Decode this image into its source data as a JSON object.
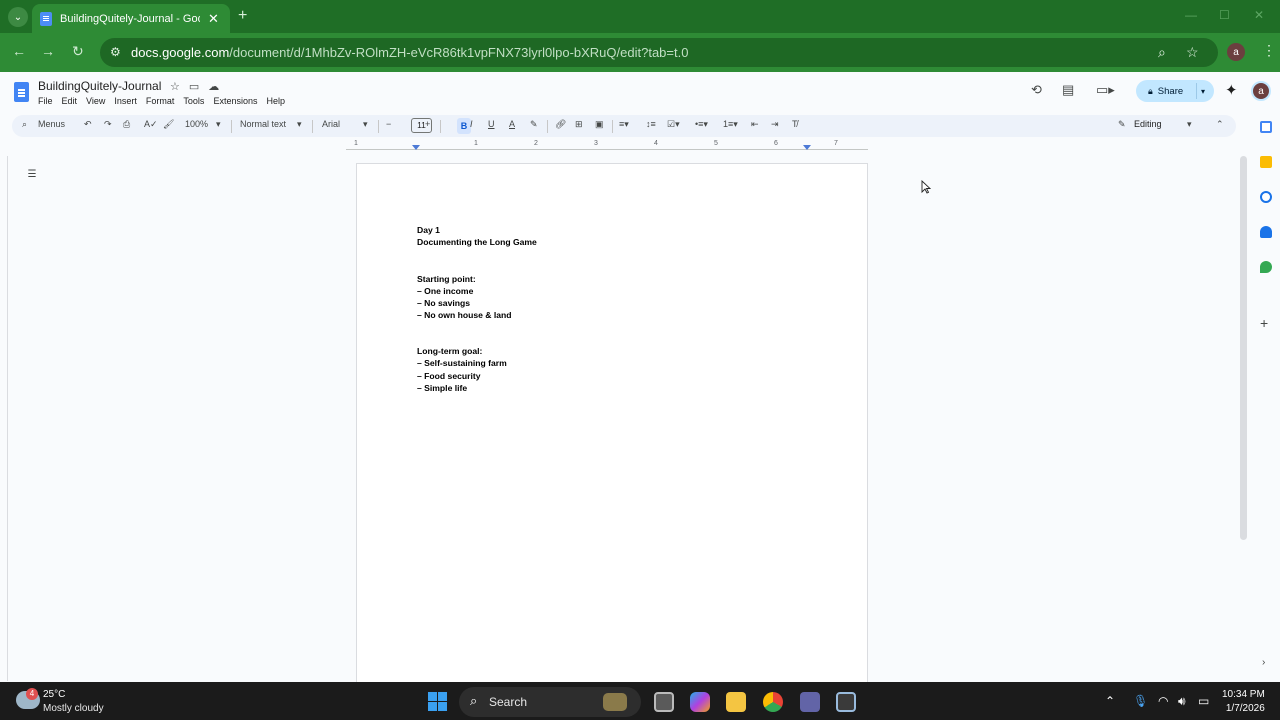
{
  "browser": {
    "tab_title": "BuildingQuitely-Journal - Goog",
    "tab_close": "✕",
    "new_tab": "+",
    "url_host": "docs.google.com",
    "url_path": "/document/d/1MhbZv-ROlmZH-eVcR86tk1vpFNX73lyrl0lpo-bXRuQ/edit?tab=t.0",
    "profile_initial": "a"
  },
  "docs": {
    "title": "BuildingQuitely-Journal",
    "menu": [
      "File",
      "Edit",
      "View",
      "Insert",
      "Format",
      "Tools",
      "Extensions",
      "Help"
    ],
    "share_label": "Share",
    "avatar_initial": "a"
  },
  "toolbar": {
    "menus_label": "Menus",
    "zoom": "100%",
    "style": "Normal text",
    "font": "Arial",
    "font_size": "11",
    "bold": "B",
    "italic": "I",
    "underline": "U",
    "text_color": "A",
    "mode": "Editing"
  },
  "ruler": {
    "numbers": [
      "1",
      "1",
      "2",
      "3",
      "4",
      "5",
      "6",
      "7"
    ]
  },
  "document": {
    "lines": [
      "Day 1",
      "Documenting the Long Game",
      "",
      "Starting point:",
      "– One income",
      "– No savings",
      "– No own house & land",
      "",
      "Long-term goal:",
      "– Self-sustaining farm",
      "– Food security",
      "– Simple life"
    ]
  },
  "taskbar": {
    "weather_badge": "4",
    "temperature": "25°C",
    "condition": "Mostly cloudy",
    "search_label": "Search",
    "time": "10:34 PM",
    "date": "1/7/2026"
  },
  "colors": {
    "chrome_green": "#2e8b35",
    "share_blue": "#c2e7ff",
    "docs_blue": "#4285f4"
  }
}
